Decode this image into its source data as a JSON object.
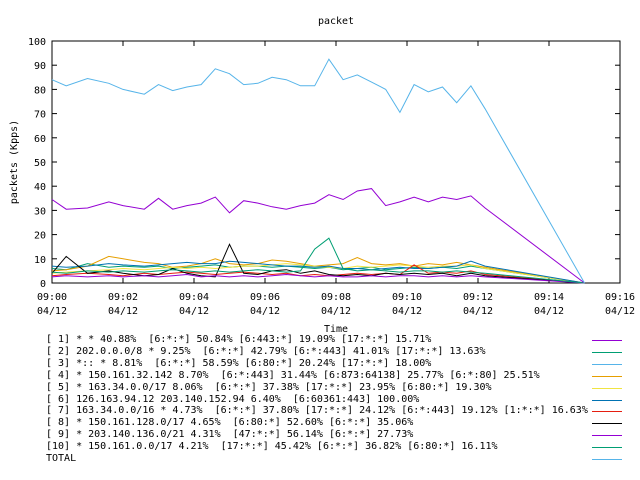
{
  "chart_data": {
    "type": "line",
    "title": "packet",
    "xlabel": "Time",
    "ylabel": "packets (Kpps)",
    "ylim": [
      0,
      100
    ],
    "y_ticks": [
      "0",
      "10",
      "20",
      "30",
      "40",
      "50",
      "60",
      "70",
      "80",
      "90",
      "100"
    ],
    "x_ticks": [
      {
        "time": "09:00",
        "date": "04/12"
      },
      {
        "time": "09:02",
        "date": "04/12"
      },
      {
        "time": "09:04",
        "date": "04/12"
      },
      {
        "time": "09:06",
        "date": "04/12"
      },
      {
        "time": "09:08",
        "date": "04/12"
      },
      {
        "time": "09:10",
        "date": "04/12"
      },
      {
        "time": "09:12",
        "date": "04/12"
      },
      {
        "time": "09:14",
        "date": "04/12"
      },
      {
        "time": "09:16",
        "date": "04/12"
      }
    ],
    "x_minutes": [
      0,
      0.4,
      1,
      1.6,
      2,
      2.6,
      3,
      3.4,
      3.8,
      4.2,
      4.6,
      5,
      5.4,
      5.8,
      6.2,
      6.6,
      7,
      7.4,
      7.8,
      8.2,
      8.6,
      9,
      9.4,
      9.8,
      10.2,
      10.6,
      11,
      11.4,
      11.8,
      12.2,
      12.6,
      13,
      13.4,
      13.8,
      14.2,
      14.6,
      15
    ],
    "series": [
      {
        "name": "[ 1] * * 40.88%  [6:*:*] 50.84% [6:443:*] 19.09% [17:*:*] 15.71%",
        "color": "#9400d3",
        "values": [
          34.5,
          30.5,
          31,
          33.5,
          32,
          30.5,
          35,
          30.5,
          32,
          33,
          35.5,
          29,
          34,
          33,
          31.5,
          30.5,
          32,
          33,
          36.5,
          34.5,
          38,
          39,
          32,
          33.5,
          35.5,
          33.5,
          35.5,
          34.5,
          36,
          31,
          0
        ]
      },
      {
        "name": "[ 2] 202.0.0.0/8 * 9.25%  [6:*:*] 42.79% [6:*:443] 41.01% [17:*:*] 13.63%",
        "color": "#009e73",
        "values": [
          6,
          5.5,
          8,
          6.5,
          7,
          6.5,
          7,
          6,
          6.5,
          7,
          7.5,
          6.5,
          7,
          7,
          6.5,
          7,
          6.5,
          6,
          6.5,
          5.5,
          6,
          6.5,
          5.5,
          6,
          6.5,
          6,
          6.5,
          6,
          7,
          6,
          0
        ]
      },
      {
        "name": "[ 3] *:: * 8.81%  [6:*:*] 58.59% [6:80:*] 20.24% [17:*:*] 18.00%",
        "color": "#56b4e9",
        "values": [
          84,
          81.5,
          84.5,
          82.5,
          80,
          78,
          82,
          79.5,
          81,
          82,
          88.5,
          86.5,
          82,
          82.5,
          85,
          84,
          81.5,
          81.5,
          92.5,
          84,
          86,
          83,
          80,
          70.5,
          82,
          79,
          81,
          74.5,
          81.5,
          72,
          0
        ]
      },
      {
        "name": "[ 4] * 150.161.32.142 8.70%  [6:*:443] 31.44% [6:873:64138] 25.77% [6:*:80] 25.51%",
        "color": "#e69f00",
        "values": [
          5,
          5.5,
          7,
          11,
          10,
          8.5,
          8,
          6.5,
          7,
          8,
          10,
          8,
          7.5,
          8,
          9.5,
          9,
          8,
          7,
          7.5,
          8,
          10.5,
          8,
          7.5,
          8,
          7,
          8,
          7.5,
          8.5,
          7.5,
          6.5,
          0
        ]
      },
      {
        "name": "[ 5] * 163.34.0.0/17 8.06%  [6:*:*] 37.38% [17:*:*] 23.95% [6:80:*] 19.30%",
        "color": "#f0e442",
        "values": [
          4,
          4.5,
          5,
          5.5,
          6,
          5.5,
          6,
          6.5,
          6,
          6.5,
          6,
          6.5,
          7,
          7,
          7.5,
          8,
          7.5,
          7,
          6.5,
          6,
          7,
          6.5,
          7,
          7.5,
          7,
          6.5,
          7,
          7,
          7.5,
          6,
          0
        ]
      },
      {
        "name": "[ 6] 126.163.94.12 203.140.152.94 6.40%  [6:60361:443] 100.00%",
        "color": "#0072b2",
        "values": [
          7,
          6.5,
          7,
          8,
          7.5,
          7,
          7.5,
          8,
          8.5,
          8,
          8,
          9,
          8.5,
          8,
          7.5,
          7,
          7,
          6.5,
          7,
          6,
          6,
          5.5,
          6,
          6.5,
          6,
          6,
          6.5,
          7,
          9,
          7,
          0
        ]
      },
      {
        "name": "[ 7] 163.34.0.0/16 * 4.73%  [6:*:*] 37.80% [17:*:*] 24.12% [6:*:443] 19.12% [1:*:*] 16.63%",
        "color": "#e51e10",
        "values": [
          3,
          3.5,
          4,
          3.5,
          3,
          4,
          3.5,
          4,
          4.5,
          4,
          3.5,
          4,
          4.5,
          4,
          3.5,
          4,
          3,
          3.5,
          3,
          3.5,
          4,
          3.5,
          4,
          3.5,
          7.5,
          4,
          4.5,
          4,
          5,
          3.5,
          0
        ]
      },
      {
        "name": "[ 8] * 150.161.128.0/17 4.65%  [6:80:*] 52.60% [6:*:*] 35.06%",
        "color": "#000000",
        "values": [
          4,
          11,
          4,
          5,
          4,
          3,
          3.5,
          6,
          4,
          3,
          2.5,
          16,
          4,
          3.5,
          5,
          5.5,
          4,
          5,
          3.5,
          3,
          3.5,
          3,
          4,
          3.5,
          4,
          3.5,
          4,
          3,
          4,
          3,
          0
        ]
      },
      {
        "name": "[ 9] * 203.140.136.0/21 4.31%  [47:*:*] 56.14% [6:*:*] 27.73%",
        "color": "#9400d3",
        "values": [
          2.5,
          3,
          2.5,
          3,
          2.5,
          3,
          2.5,
          3,
          3.5,
          2.5,
          3,
          2.5,
          3,
          2.5,
          3,
          3.5,
          3,
          2.5,
          3,
          2.5,
          2.5,
          3,
          2.5,
          3,
          3,
          2.5,
          3,
          2.5,
          3,
          2.5,
          0
        ]
      },
      {
        "name": "[10] * 150.161.0.0/17 4.21%  [17:*:*] 45.42% [6:*:*] 36.82% [6:80:*] 16.11%",
        "color": "#009e73",
        "values": [
          4.5,
          4,
          5,
          4.5,
          5,
          4.5,
          5,
          5.5,
          5,
          4.5,
          5,
          4.5,
          5,
          5.5,
          5,
          4.5,
          5,
          14,
          18.5,
          6,
          5,
          5.5,
          5,
          4.5,
          5,
          5,
          4.5,
          5,
          4.5,
          4,
          0
        ]
      },
      {
        "name": "TOTAL",
        "color": "#56b4e9",
        "values": []
      }
    ]
  }
}
